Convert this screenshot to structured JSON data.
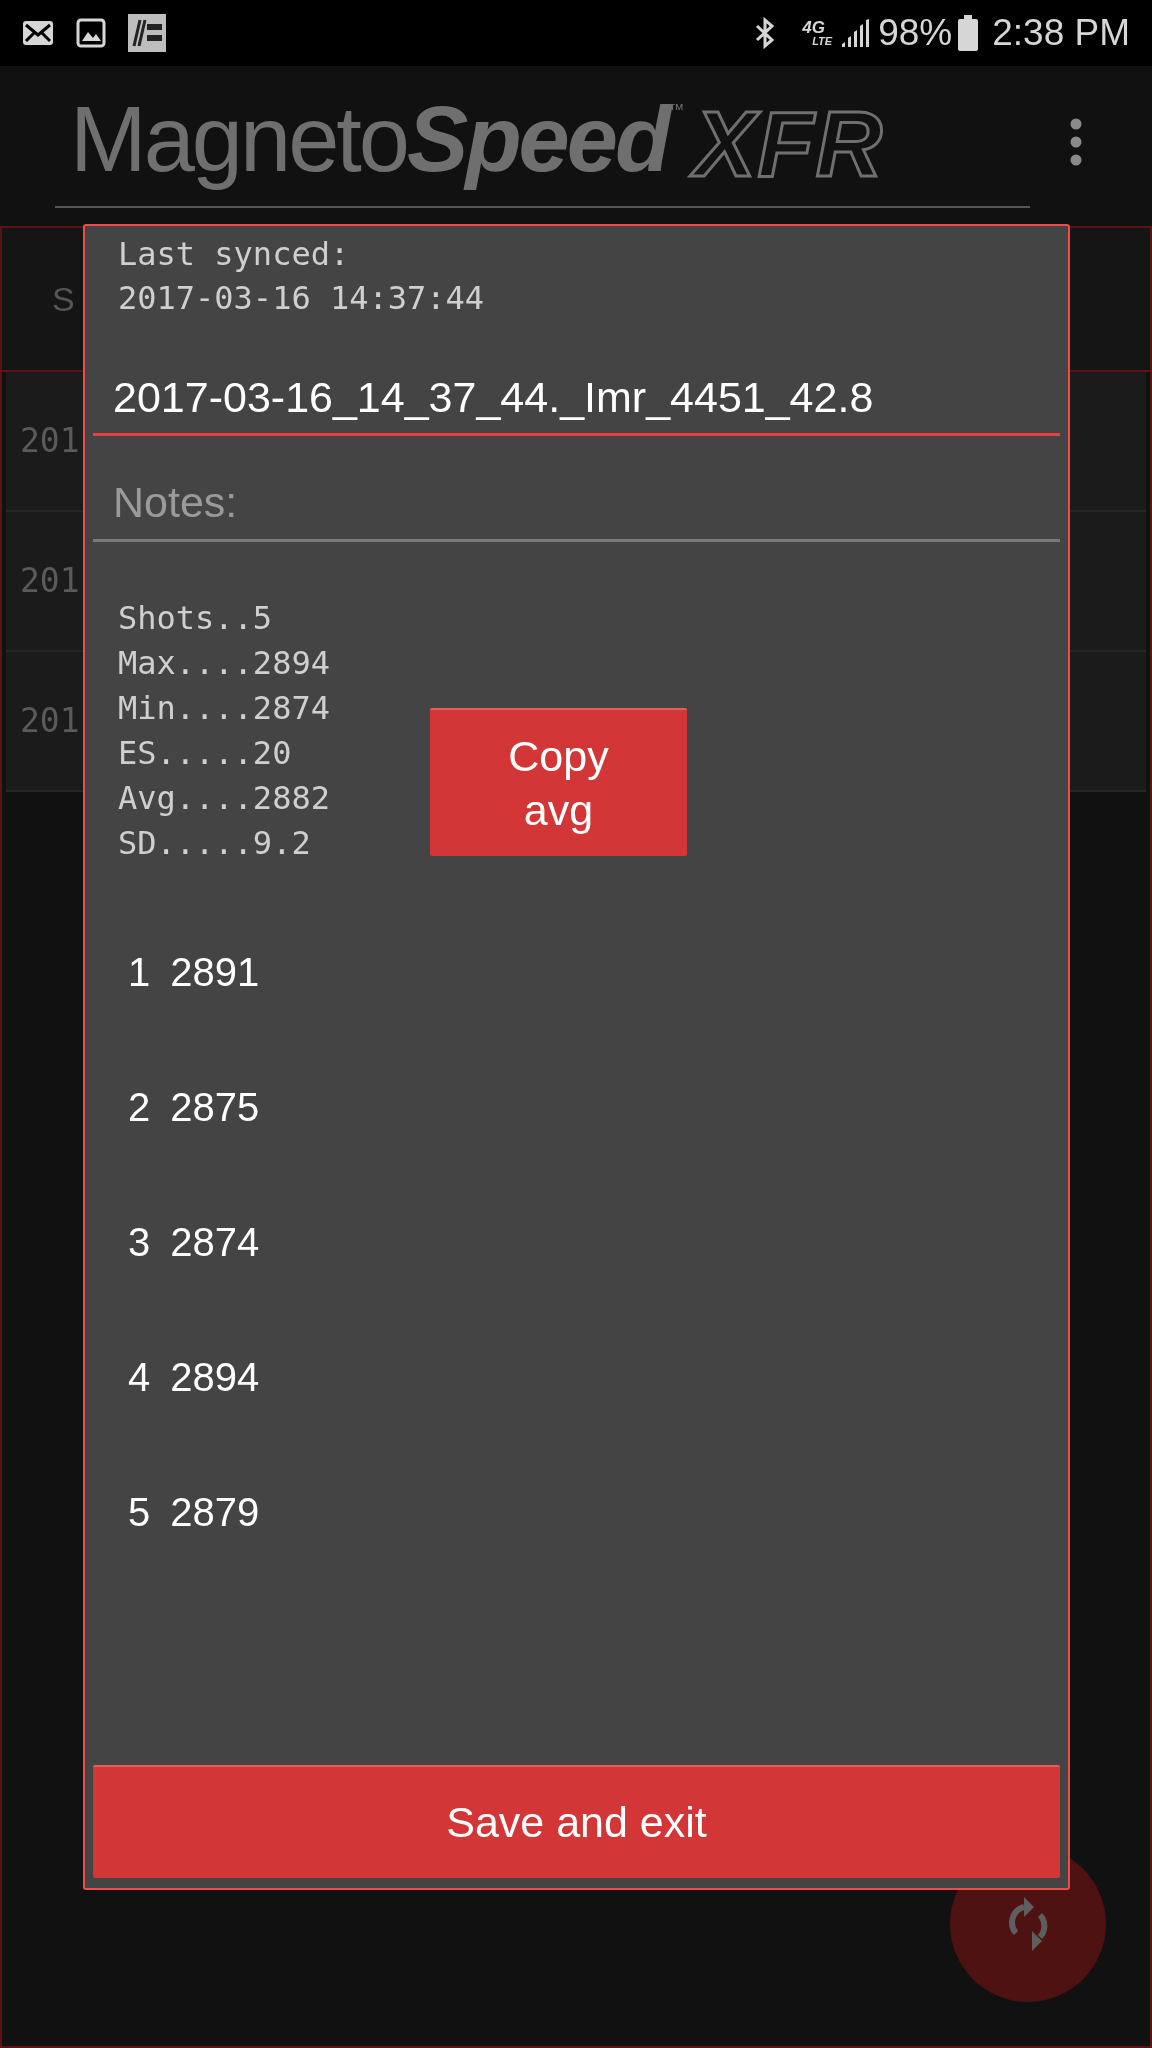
{
  "status_bar": {
    "network": "4G",
    "network_sub": "LTE",
    "battery": "98%",
    "time": "2:38 PM"
  },
  "app_bar": {
    "logo_regular": "Magneto",
    "logo_bold": "Speed",
    "trademark": "™",
    "logo_suffix": "XFR"
  },
  "background": {
    "tab_partial": "S",
    "rows": [
      "201",
      "201",
      "201"
    ]
  },
  "dialog": {
    "last_synced_label": "Last synced:",
    "last_synced_value": "2017-03-16 14:37:44",
    "name_value": "2017-03-16_14_37_44._Imr_4451_42.8",
    "notes_placeholder": "Notes:",
    "stats": [
      "Shots..5",
      "Max....2894",
      "Min....2874",
      "ES.....20",
      "Avg....2882",
      "SD.....9.2"
    ],
    "copy_button": "Copy avg",
    "shots": [
      {
        "index": "1",
        "value": "2891"
      },
      {
        "index": "2",
        "value": "2875"
      },
      {
        "index": "3",
        "value": "2874"
      },
      {
        "index": "4",
        "value": "2894"
      },
      {
        "index": "5",
        "value": "2879"
      }
    ],
    "save_button": "Save and exit"
  }
}
